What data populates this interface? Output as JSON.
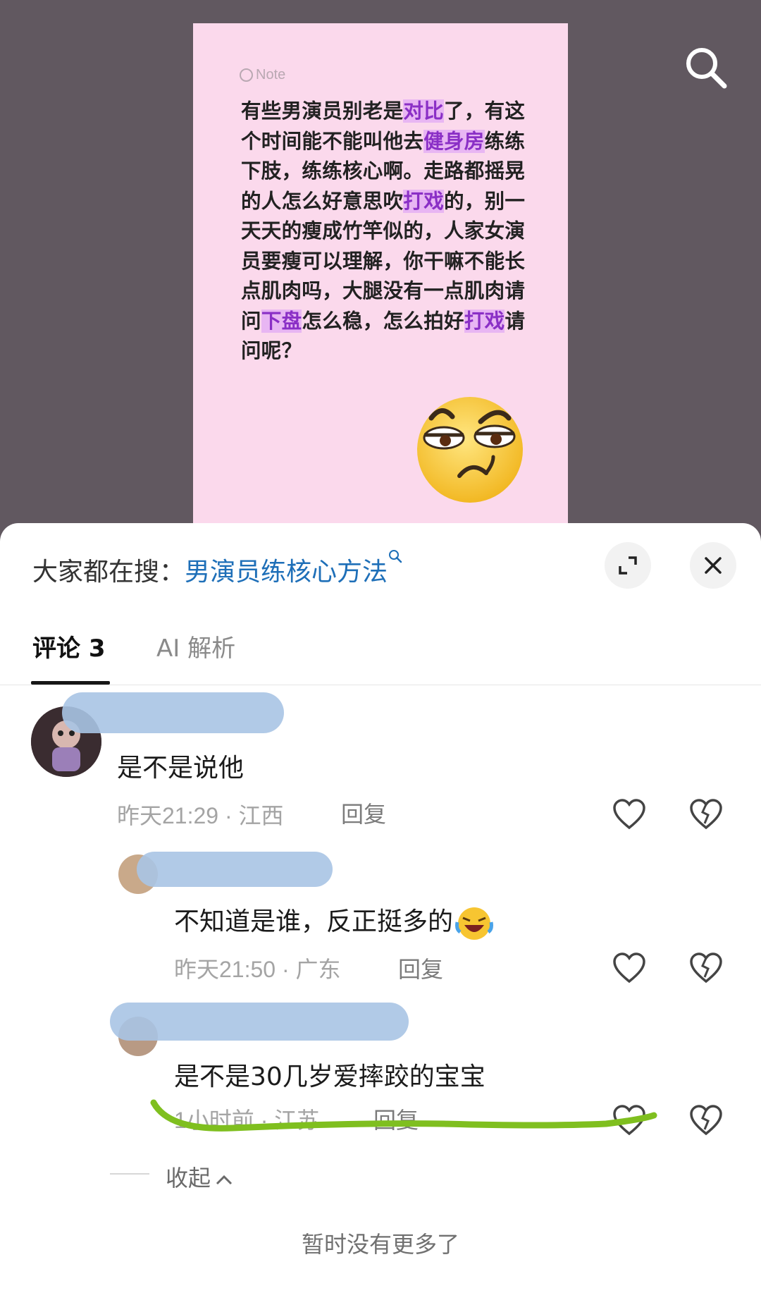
{
  "note": {
    "header": "Note",
    "segments": [
      {
        "t": "有些男演员别老是"
      },
      {
        "t": "对比",
        "h": true
      },
      {
        "t": "了，有这个时间能不能叫他去"
      },
      {
        "t": "健身房",
        "h": true
      },
      {
        "t": "练练下肢，练练核心啊。走路都摇晃的人怎么好意思吹"
      },
      {
        "t": "打戏",
        "h": true
      },
      {
        "t": "的，别一天天的瘦成竹竿似的，人家女演员要瘦可以理解，你干嘛不能长点肌肉吗，大腿没有一点肌肉请问"
      },
      {
        "t": "下盘",
        "h": true
      },
      {
        "t": "怎么稳，怎么拍好"
      },
      {
        "t": "打戏",
        "h": true
      },
      {
        "t": "请问呢？"
      }
    ]
  },
  "search_bar": {
    "prefix": "大家都在搜：",
    "term": "男演员练核心方法"
  },
  "tabs": {
    "comments": "评论 3",
    "ai": "AI 解析"
  },
  "comments": [
    {
      "text": "是不是说他",
      "time": "昨天21:29",
      "location": "江西",
      "reply": "回复"
    },
    {
      "text": "不知道是谁，反正挺多的",
      "time": "昨天21:50",
      "location": "广东",
      "reply": "回复"
    },
    {
      "text": "是不是30几岁爱摔跤的宝宝",
      "time": "1小时前",
      "location": "江苏",
      "reply": "回复"
    }
  ],
  "collapse_label": "收起",
  "no_more_label": "暂时没有更多了",
  "colors": {
    "highlight_bg": "#e8b6f3",
    "highlight_text": "#8a2fc6",
    "search_term": "#1e6fb8",
    "green_annotation": "#7fbf1f"
  }
}
